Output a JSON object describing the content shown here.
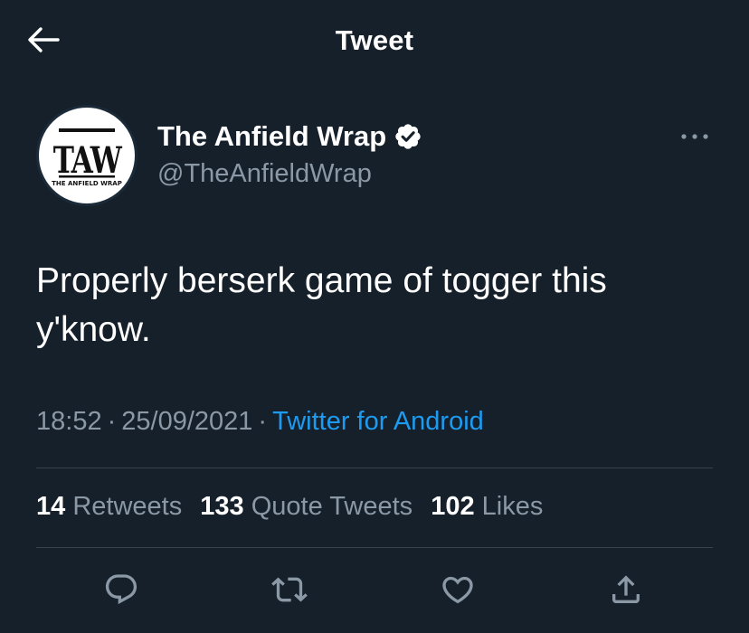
{
  "header": {
    "title": "Tweet"
  },
  "author": {
    "display_name": "The Anfield Wrap",
    "handle": "@TheAnfieldWrap",
    "verified": true,
    "avatar_logo_text": "TAW",
    "avatar_logo_subtext": "THE ANFIELD WRAP"
  },
  "tweet": {
    "text": "Properly berserk game of togger this y'know.",
    "time": "18:52",
    "date": "25/09/2021",
    "separator": "·",
    "source": "Twitter for Android"
  },
  "stats": [
    {
      "count": "14",
      "label": "Retweets"
    },
    {
      "count": "133",
      "label": "Quote Tweets"
    },
    {
      "count": "102",
      "label": "Likes"
    }
  ],
  "actions": [
    {
      "name": "reply",
      "icon": "reply-icon"
    },
    {
      "name": "retweet",
      "icon": "retweet-icon"
    },
    {
      "name": "like",
      "icon": "heart-icon"
    },
    {
      "name": "share",
      "icon": "share-icon"
    }
  ],
  "colors": {
    "background": "#15202b",
    "text": "#ffffff",
    "secondary_text": "#8b98a5",
    "link": "#1d9bf0",
    "divider": "#38444d"
  }
}
